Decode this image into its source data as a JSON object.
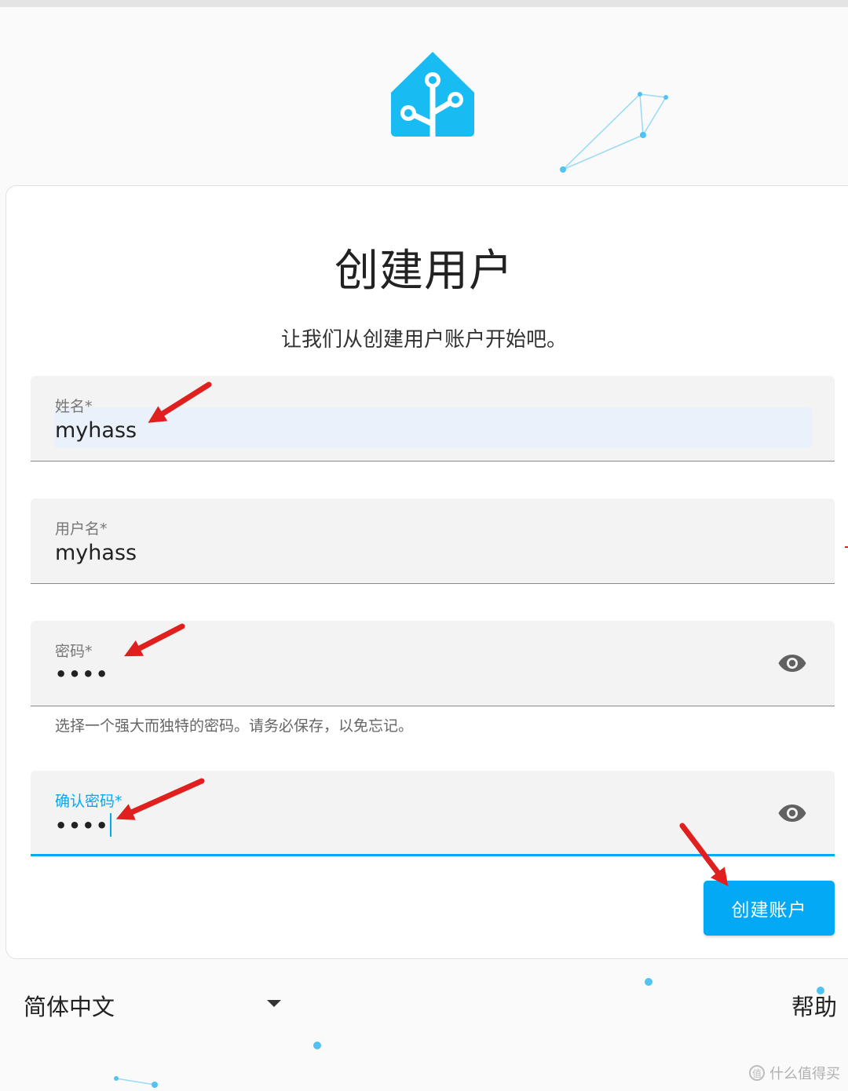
{
  "page": {
    "title": "创建用户",
    "subtitle": "让我们从创建用户账户开始吧。"
  },
  "form": {
    "name": {
      "label": "姓名*",
      "value": "myhass"
    },
    "username": {
      "label": "用户名*",
      "value": "myhass"
    },
    "password": {
      "label": "密码*",
      "value": "••••",
      "helper": "选择一个强大而独特的密码。请务必保存，以免忘记。",
      "toggle_icon": "eye-icon"
    },
    "confirm_password": {
      "label": "确认密码*",
      "value": "••••",
      "toggle_icon": "eye-icon",
      "focused": true
    },
    "submit_label": "创建账户"
  },
  "footer": {
    "language": "简体中文",
    "help": "帮助"
  },
  "watermark": {
    "text": "什么值得买",
    "icon_text": "值"
  },
  "colors": {
    "accent": "#03a9f4",
    "logo": "#18bcf2",
    "annotation_arrow": "#e0201e"
  }
}
